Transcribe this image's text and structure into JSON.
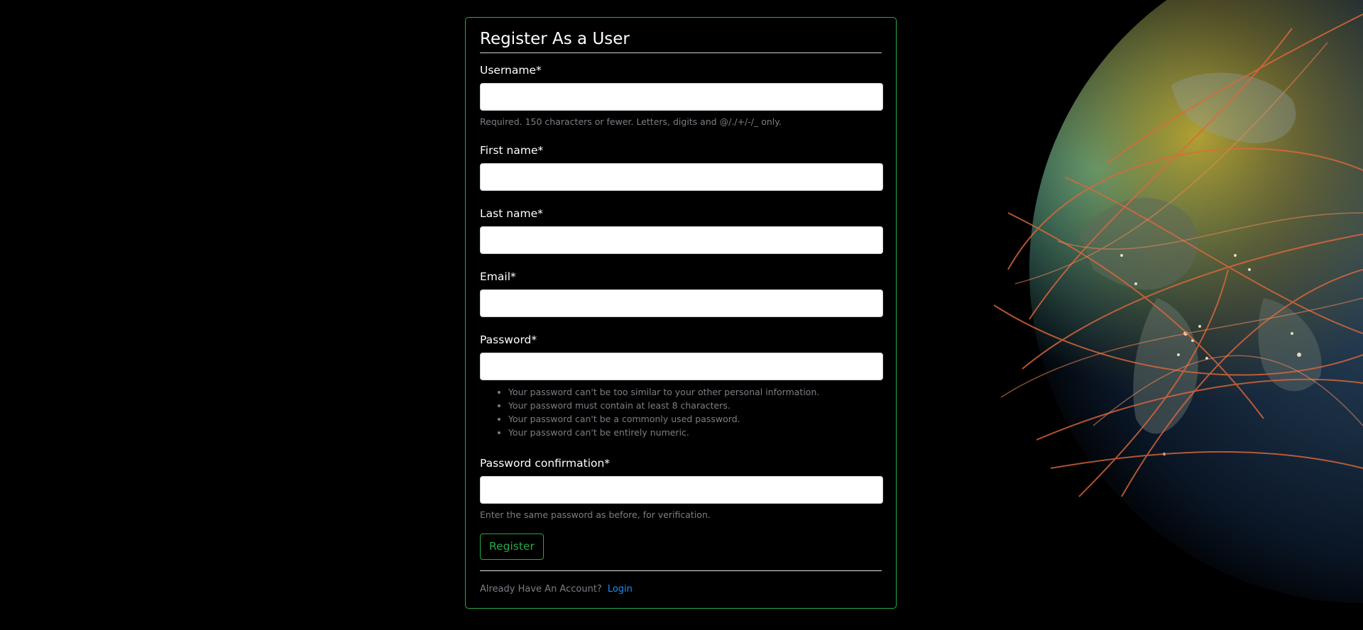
{
  "form": {
    "title": "Register As a User",
    "fields": {
      "username": {
        "label": "Username*",
        "value": "",
        "help": "Required. 150 characters or fewer. Letters, digits and @/./+/-/_ only."
      },
      "first_name": {
        "label": "First name*",
        "value": ""
      },
      "last_name": {
        "label": "Last name*",
        "value": ""
      },
      "email": {
        "label": "Email*",
        "value": ""
      },
      "password": {
        "label": "Password*",
        "value": "",
        "help_items": [
          "Your password can't be too similar to your other personal information.",
          "Your password must contain at least 8 characters.",
          "Your password can't be a commonly used password.",
          "Your password can't be entirely numeric."
        ]
      },
      "password_confirmation": {
        "label": "Password confirmation*",
        "value": "",
        "help": "Enter the same password as before, for verification."
      }
    },
    "submit_label": "Register",
    "footer_text": "Already Have An Account?",
    "login_link": "Login"
  },
  "colors": {
    "background": "#000000",
    "accent": "#28a745",
    "link": "#1e90ff",
    "help_text": "#7a7f85"
  },
  "icons": {
    "background_image": "globe-network-image"
  }
}
